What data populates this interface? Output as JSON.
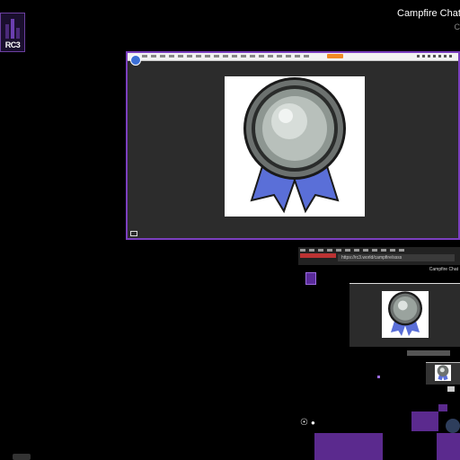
{
  "app": {
    "logo_text": "RC3",
    "room_title": "Campfire Chat",
    "room_subtitle": "C"
  },
  "main_window": {
    "image_alt_icon": "medal-badge-icon"
  },
  "nested_window": {
    "url_text": "https://rc3.world/campfire/ssss"
  },
  "colors": {
    "accent": "#7b3fbf",
    "background": "#000000",
    "window_bg": "#2c2c2c",
    "medal_ribbon": "#5a6fd8",
    "medal_rim": "#7a7f7d"
  }
}
